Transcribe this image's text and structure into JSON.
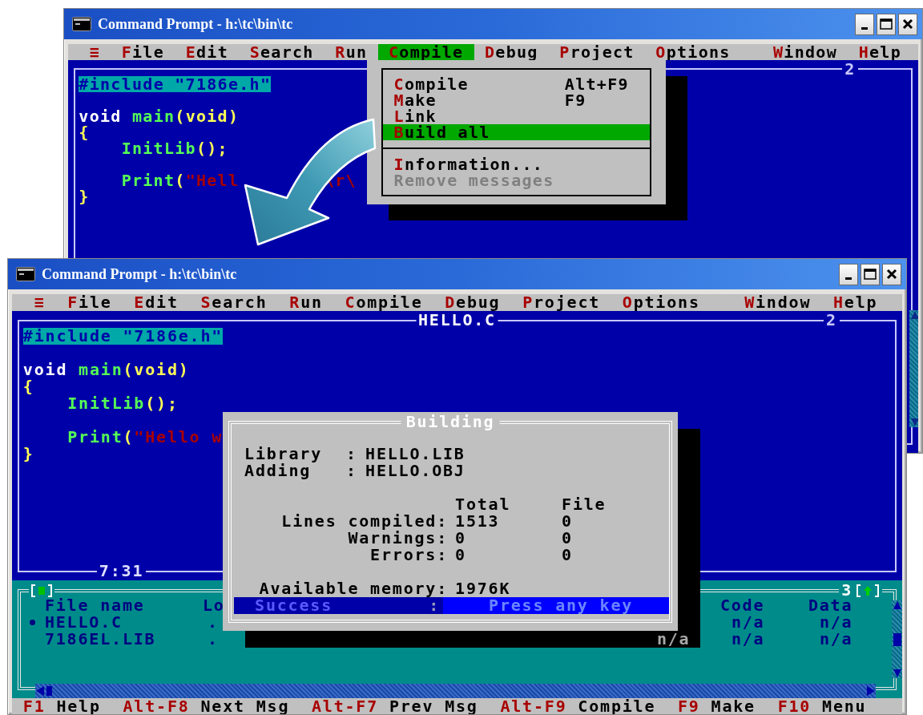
{
  "windows": [
    {
      "title": "Command Prompt - h:\\tc\\bin\\tc",
      "menu": [
        {
          "label": "≡",
          "selected": false
        },
        {
          "label": "File",
          "selected": false
        },
        {
          "label": "Edit",
          "selected": false
        },
        {
          "label": "Search",
          "selected": false
        },
        {
          "label": "Run",
          "selected": false
        },
        {
          "label": "Compile",
          "selected": true
        },
        {
          "label": "Debug",
          "selected": false
        },
        {
          "label": "Project",
          "selected": false
        },
        {
          "label": "Options",
          "selected": false
        }
      ],
      "menu_right": [
        {
          "label": "Window",
          "selected": false
        },
        {
          "label": "Help",
          "selected": false
        }
      ],
      "editor": {
        "number": "2",
        "lines": [
          {
            "kind": "code",
            "indented": false,
            "tokens": [
              {
                "kind": "block",
                "text": "#include \"7186e.h\""
              }
            ]
          },
          {
            "kind": "blank"
          },
          {
            "kind": "code",
            "indented": false,
            "tokens": [
              {
                "kind": "keyword",
                "text": "void"
              },
              {
                "kind": "function",
                "text": "main"
              },
              {
                "kind": "punct",
                "text": "(void)"
              }
            ]
          },
          {
            "kind": "code",
            "indented": false,
            "tokens": [
              {
                "kind": "punct",
                "text": "{"
              }
            ]
          },
          {
            "kind": "code",
            "indented": true,
            "tokens": [
              {
                "kind": "function",
                "text": "InitLib"
              },
              {
                "kind": "punct",
                "text": "();"
              }
            ]
          },
          {
            "kind": "blank"
          },
          {
            "kind": "code",
            "indented": true,
            "tokens": [
              {
                "kind": "function",
                "text": "Print"
              },
              {
                "kind": "punct",
                "text": "("
              },
              {
                "kind": "string",
                "text": "\"Hell"
              },
              {
                "kind": "string_tail",
                "text": "\\r\\"
              }
            ]
          },
          {
            "kind": "code",
            "indented": false,
            "tokens": [
              {
                "kind": "punct",
                "text": "}"
              }
            ]
          }
        ]
      },
      "dropdown": {
        "items": [
          {
            "kind": "item",
            "label": "Compile",
            "shortcut": "Alt+F9",
            "selected": false,
            "disabled": false
          },
          {
            "kind": "item",
            "label": "Make",
            "shortcut": "F9",
            "selected": false,
            "disabled": false
          },
          {
            "kind": "item",
            "label": "Link",
            "selected": false,
            "disabled": false
          },
          {
            "kind": "item",
            "label": "Build all",
            "selected": true,
            "disabled": false
          },
          {
            "kind": "separator"
          },
          {
            "kind": "item",
            "label": "Information...",
            "selected": false,
            "disabled": false
          },
          {
            "kind": "item",
            "label": "Remove messages",
            "selected": false,
            "disabled": true
          }
        ]
      }
    },
    {
      "title": "Command Prompt - h:\\tc\\bin\\tc",
      "menu": [
        {
          "label": "≡",
          "selected": false
        },
        {
          "label": "File",
          "selected": false
        },
        {
          "label": "Edit",
          "selected": false
        },
        {
          "label": "Search",
          "selected": false
        },
        {
          "label": "Run",
          "selected": false
        },
        {
          "label": "Compile",
          "selected": false
        },
        {
          "label": "Debug",
          "selected": false
        },
        {
          "label": "Project",
          "selected": false
        },
        {
          "label": "Options",
          "selected": false
        }
      ],
      "menu_right": [
        {
          "label": "Window",
          "selected": false
        },
        {
          "label": "Help",
          "selected": false
        }
      ],
      "editor": {
        "title": "HELLO.C",
        "number": "2",
        "position": "7:31",
        "lines": [
          {
            "kind": "code",
            "indented": false,
            "tokens": [
              {
                "kind": "block",
                "text": "#include \"7186e.h\""
              }
            ]
          },
          {
            "kind": "blank"
          },
          {
            "kind": "code",
            "indented": false,
            "tokens": [
              {
                "kind": "keyword",
                "text": "void"
              },
              {
                "kind": "function",
                "text": "main"
              },
              {
                "kind": "punct",
                "text": "(void)"
              }
            ]
          },
          {
            "kind": "code",
            "indented": false,
            "tokens": [
              {
                "kind": "punct",
                "text": "{"
              }
            ]
          },
          {
            "kind": "code",
            "indented": true,
            "tokens": [
              {
                "kind": "function",
                "text": "InitLib"
              },
              {
                "kind": "punct",
                "text": "();"
              }
            ]
          },
          {
            "kind": "blank"
          },
          {
            "kind": "code",
            "indented": true,
            "tokens": [
              {
                "kind": "function",
                "text": "Print"
              },
              {
                "kind": "punct",
                "text": "("
              },
              {
                "kind": "string",
                "text": "\"Hello w"
              }
            ]
          },
          {
            "kind": "code",
            "indented": false,
            "tokens": [
              {
                "kind": "punct",
                "text": "}"
              }
            ]
          }
        ]
      },
      "messages": {
        "number": "3",
        "header": {
          "file_name": "File name",
          "column_2": "Lo",
          "code": "Code",
          "data": "Data"
        },
        "rows": [
          {
            "selected": true,
            "file_name": "HELLO.C",
            "column_2": ".",
            "code": "n/a",
            "data": "n/a"
          },
          {
            "selected": false,
            "file_name": "7186EL.LIB",
            "column_2": ".",
            "column_3": "n/a",
            "code": "n/a",
            "data": "n/a"
          }
        ]
      },
      "dialog": {
        "title": "Building",
        "fields": [
          {
            "label": "Library",
            "separator": ":",
            "value": "HELLO.LIB"
          },
          {
            "label": "Adding",
            "separator": ":",
            "value": "HELLO.OBJ"
          }
        ],
        "stats": {
          "columns": [
            "Total",
            "File"
          ],
          "rows": [
            {
              "label": "Lines compiled:",
              "total": "1513",
              "file": "0"
            },
            {
              "label": "Warnings:",
              "total": "0",
              "file": "0"
            },
            {
              "label": "Errors:",
              "total": "0",
              "file": "0"
            }
          ]
        },
        "memory": {
          "label": "Available memory:",
          "value": "1976K"
        },
        "status": {
          "label": "Success",
          "separator": ":",
          "hint": "Press any key"
        }
      },
      "status_bar": [
        {
          "key": "F1",
          "label": "Help"
        },
        {
          "key": "Alt-F8",
          "label": "Next Msg"
        },
        {
          "key": "Alt-F7",
          "label": "Prev Msg"
        },
        {
          "key": "Alt-F9",
          "label": "Compile"
        },
        {
          "key": "F9",
          "label": "Make"
        },
        {
          "key": "F10",
          "label": "Menu"
        }
      ]
    }
  ]
}
